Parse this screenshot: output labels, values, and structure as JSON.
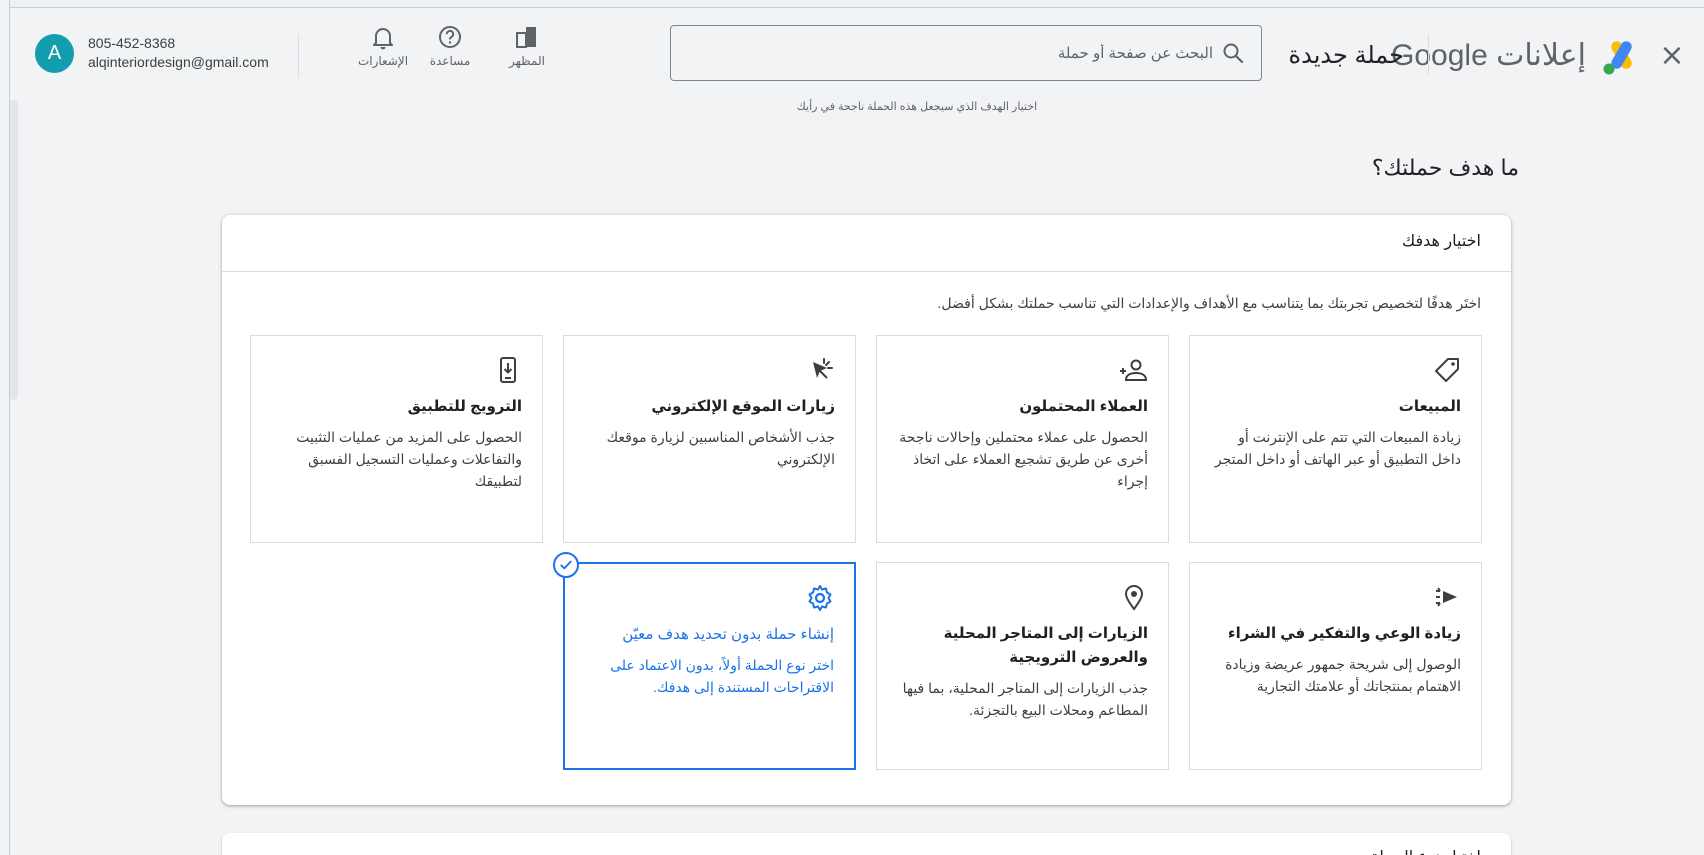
{
  "header": {
    "close_label": "×",
    "brand_text": "إعلانات",
    "brand_google": "Google",
    "campaign_title": "حملة جديدة",
    "search_placeholder": "البحث عن صفحة أو حملة",
    "actions": [
      {
        "label": "المظهر",
        "icon": "appearance-icon"
      },
      {
        "label": "مساعدة",
        "icon": "help-icon"
      },
      {
        "label": "الإشعارات",
        "icon": "bell-icon"
      }
    ],
    "account": {
      "avatar_letter": "A",
      "phone": "805-452-8368",
      "email": "alqinteriordesign@gmail.com"
    }
  },
  "subtitle": "اختيار الهدف الذي سيجعل هذه الحملة ناجحة في رأيك",
  "question": "ما هدف حملتك؟",
  "goal_card": {
    "title": "اختيار هدفك",
    "description": "اختَر هدفًا لتخصيص تجربتك بما يتناسب مع الأهداف والإعدادات التي تناسب حملتك بشكل أفضل.",
    "goals": [
      {
        "title": "المبيعات",
        "description": "زيادة المبيعات التي تتم على الإنترنت أو داخل التطبيق أو عبر الهاتف أو داخل المتجر",
        "icon": "tag-icon",
        "selected": false
      },
      {
        "title": "العملاء المحتملون",
        "description": "الحصول على عملاء محتملين وإحالات ناجحة أخرى عن طريق تشجيع العملاء على اتخاذ إجراء",
        "icon": "people-icon",
        "selected": false
      },
      {
        "title": "زيارات الموقع الإلكتروني",
        "description": "جذب الأشخاص المناسبين لزيارة موقعك الإلكتروني",
        "icon": "cursor-click-icon",
        "selected": false
      },
      {
        "title": "الترويج للتطبيق",
        "description": "الحصول على المزيد من عمليات التثبيت والتفاعلات وعمليات التسجيل الفسبق لتطبيقك",
        "icon": "phone-download-icon",
        "selected": false
      },
      {
        "title": "زيادة الوعي والتفكير في الشراء",
        "description": "الوصول إلى شريحة جمهور عريضة وزيادة الاهتمام بمنتجاتك أو علامتك التجارية",
        "icon": "megaphone-icon",
        "selected": false
      },
      {
        "title": "الزيارات إلى المتاجر المحلية والعروض الترويجية",
        "description": "جذب الزيارات إلى المتاجر المحلية، بما فيها المطاعم ومحلات البيع بالتجزئة.",
        "icon": "location-pin-icon",
        "selected": false
      },
      {
        "title": "إنشاء حملة بدون تحديد هدف معيّن",
        "description": "اختر نوع الحملة أولاً، بدون الاعتماد على الاقتراحات المستندة إلى هدفك.",
        "icon": "gear-icon",
        "selected": true
      }
    ]
  },
  "next_card_title": "اختيار نوع الحملة",
  "colors": {
    "accent": "#1a73e8",
    "avatar": "#129eaf",
    "background": "#f1f3f4"
  }
}
